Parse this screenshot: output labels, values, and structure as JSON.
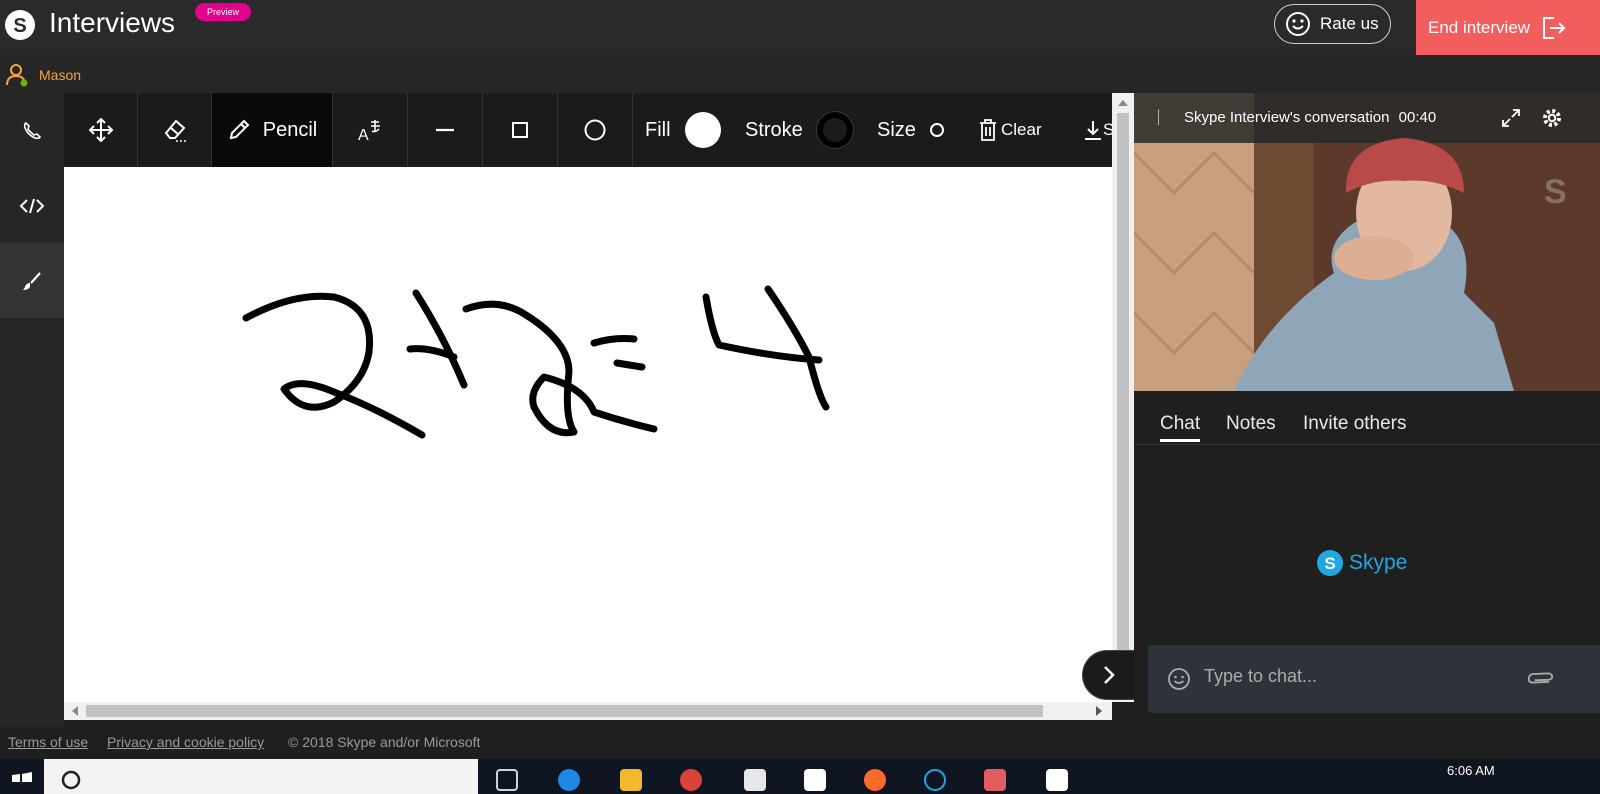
{
  "app": {
    "title": "Interviews",
    "badge": "Preview"
  },
  "header": {
    "rate_label": "Rate us",
    "end_label": "End interview"
  },
  "user": {
    "name": "Mason"
  },
  "toolbar": {
    "pencil_label": "Pencil",
    "fill_label": "Fill",
    "stroke_label": "Stroke",
    "size_label": "Size",
    "clear_label": "Clear",
    "save_label": "S"
  },
  "conversation": {
    "title": "Skype Interview's conversation",
    "timer": "00:40"
  },
  "tabs": [
    {
      "label": "Chat",
      "active": true
    },
    {
      "label": "Notes",
      "active": false
    },
    {
      "label": "Invite others",
      "active": false
    }
  ],
  "chat": {
    "brand": "Skype",
    "placeholder": "Type to chat..."
  },
  "footer": {
    "terms": "Terms of use",
    "privacy": "Privacy and cookie policy",
    "copyright": "© 2018 Skype and/or Microsoft"
  },
  "taskbar": {
    "time": "6:06 AM"
  },
  "colors": {
    "accent_end": "#f25d5d",
    "user": "#f7a43a",
    "badge": "#e3008c",
    "skype": "#1ea8e2"
  }
}
